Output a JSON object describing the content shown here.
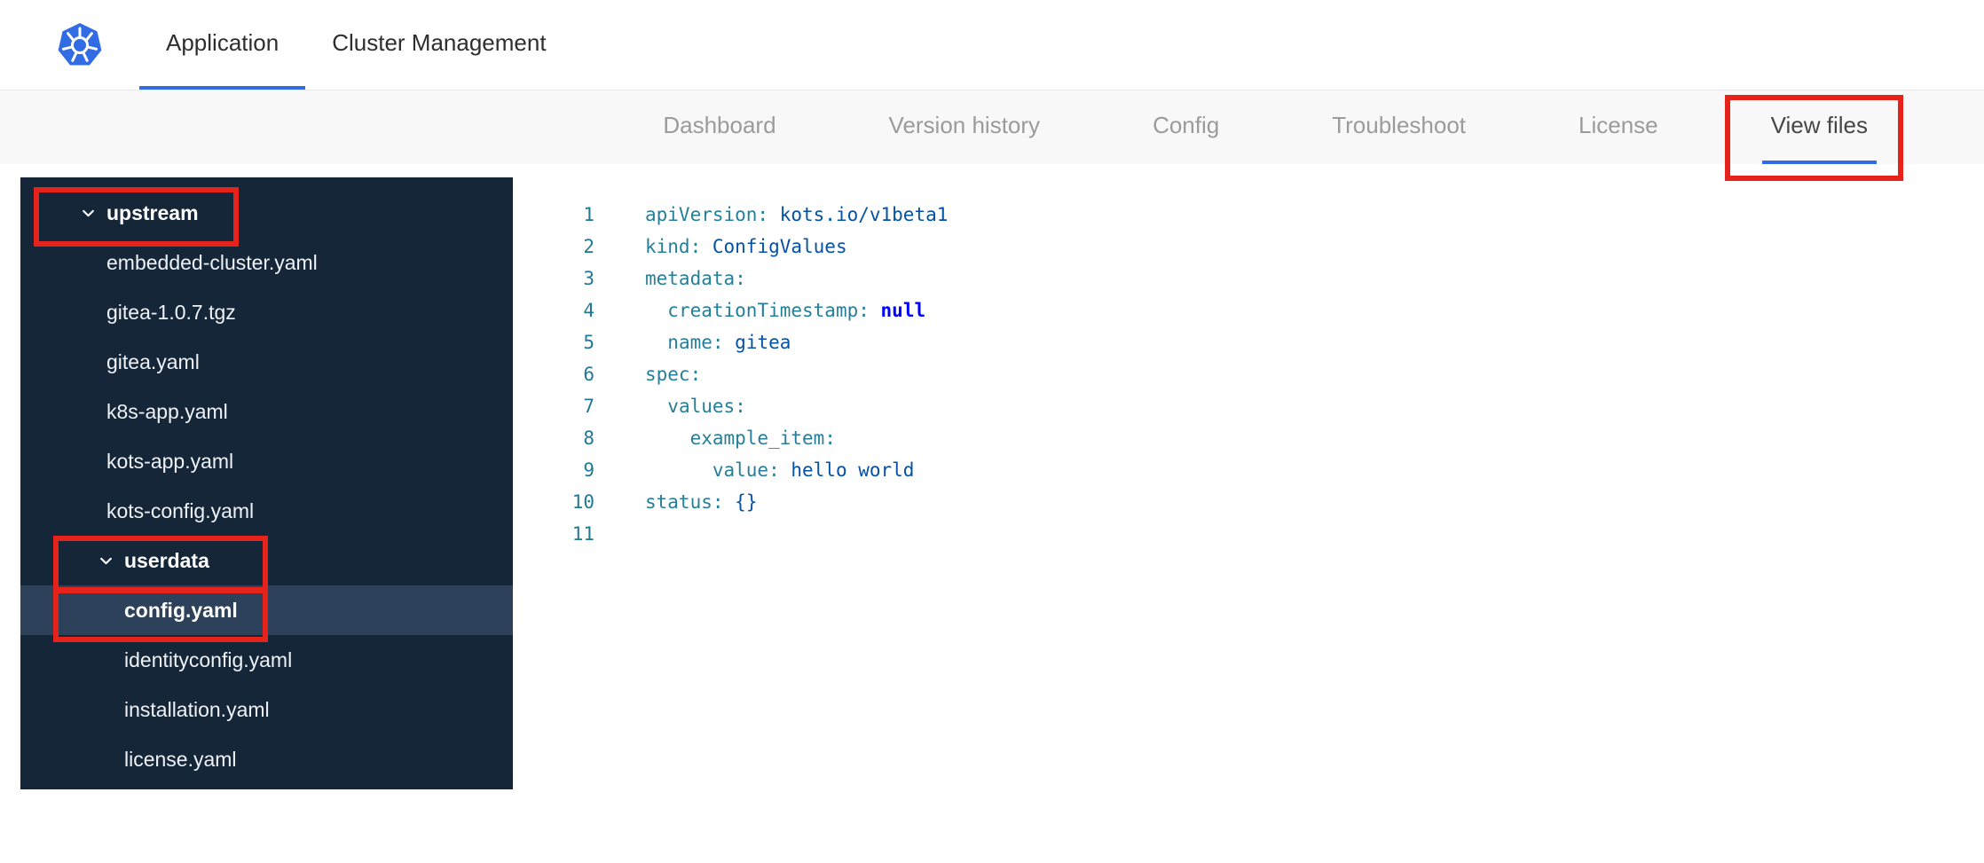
{
  "colors": {
    "accent_blue": "#326ce5",
    "annotation_red": "#e5231b",
    "sidebar_bg": "#152639",
    "sidebar_selected_bg": "#2e415a",
    "token_key": "#267f99",
    "token_value": "#0451a5",
    "token_null": "#0000ff",
    "token_plain": "#333333",
    "line_number": "#237893"
  },
  "header": {
    "logo": "kubernetes-logo",
    "tabs": [
      {
        "label": "Application",
        "active": true
      },
      {
        "label": "Cluster Management",
        "active": false
      }
    ]
  },
  "subnav": {
    "tabs": [
      {
        "label": "Dashboard",
        "active": false
      },
      {
        "label": "Version history",
        "active": false
      },
      {
        "label": "Config",
        "active": false
      },
      {
        "label": "Troubleshoot",
        "active": false
      },
      {
        "label": "License",
        "active": false
      },
      {
        "label": "View files",
        "active": true,
        "annotated": true
      }
    ]
  },
  "file_tree": {
    "items": [
      {
        "label": "upstream",
        "type": "folder",
        "expanded": true,
        "level": 0,
        "annotated": true
      },
      {
        "label": "embedded-cluster.yaml",
        "type": "file",
        "level": 1
      },
      {
        "label": "gitea-1.0.7.tgz",
        "type": "file",
        "level": 1
      },
      {
        "label": "gitea.yaml",
        "type": "file",
        "level": 1
      },
      {
        "label": "k8s-app.yaml",
        "type": "file",
        "level": 1
      },
      {
        "label": "kots-app.yaml",
        "type": "file",
        "level": 1
      },
      {
        "label": "kots-config.yaml",
        "type": "file",
        "level": 1
      },
      {
        "label": "userdata",
        "type": "folder",
        "expanded": true,
        "level": 1,
        "annotated": true
      },
      {
        "label": "config.yaml",
        "type": "file",
        "level": 2,
        "selected": true,
        "annotated": true
      },
      {
        "label": "identityconfig.yaml",
        "type": "file",
        "level": 2
      },
      {
        "label": "installation.yaml",
        "type": "file",
        "level": 2
      },
      {
        "label": "license.yaml",
        "type": "file",
        "level": 2
      }
    ]
  },
  "editor": {
    "language": "yaml",
    "lines": [
      {
        "number": 1,
        "tokens": [
          {
            "t": "apiVersion:",
            "c": "key"
          },
          {
            "t": " ",
            "c": "plain"
          },
          {
            "t": "kots.io/v1beta1",
            "c": "val"
          }
        ]
      },
      {
        "number": 2,
        "tokens": [
          {
            "t": "kind:",
            "c": "key"
          },
          {
            "t": " ",
            "c": "plain"
          },
          {
            "t": "ConfigValues",
            "c": "val"
          }
        ]
      },
      {
        "number": 3,
        "tokens": [
          {
            "t": "metadata:",
            "c": "key"
          }
        ]
      },
      {
        "number": 4,
        "tokens": [
          {
            "t": "  ",
            "c": "plain"
          },
          {
            "t": "creationTimestamp:",
            "c": "key"
          },
          {
            "t": " ",
            "c": "plain"
          },
          {
            "t": "null",
            "c": "null"
          }
        ]
      },
      {
        "number": 5,
        "tokens": [
          {
            "t": "  ",
            "c": "plain"
          },
          {
            "t": "name:",
            "c": "key"
          },
          {
            "t": " ",
            "c": "plain"
          },
          {
            "t": "gitea",
            "c": "val"
          }
        ]
      },
      {
        "number": 6,
        "tokens": [
          {
            "t": "spec:",
            "c": "key"
          }
        ]
      },
      {
        "number": 7,
        "tokens": [
          {
            "t": "  ",
            "c": "plain"
          },
          {
            "t": "values:",
            "c": "key"
          }
        ]
      },
      {
        "number": 8,
        "tokens": [
          {
            "t": "    ",
            "c": "plain"
          },
          {
            "t": "example_item:",
            "c": "key"
          }
        ]
      },
      {
        "number": 9,
        "tokens": [
          {
            "t": "      ",
            "c": "plain"
          },
          {
            "t": "value:",
            "c": "key"
          },
          {
            "t": " ",
            "c": "plain"
          },
          {
            "t": "hello world",
            "c": "val"
          }
        ]
      },
      {
        "number": 10,
        "tokens": [
          {
            "t": "status:",
            "c": "key"
          },
          {
            "t": " ",
            "c": "plain"
          },
          {
            "t": "{}",
            "c": "val"
          }
        ]
      },
      {
        "number": 11,
        "tokens": []
      }
    ]
  }
}
